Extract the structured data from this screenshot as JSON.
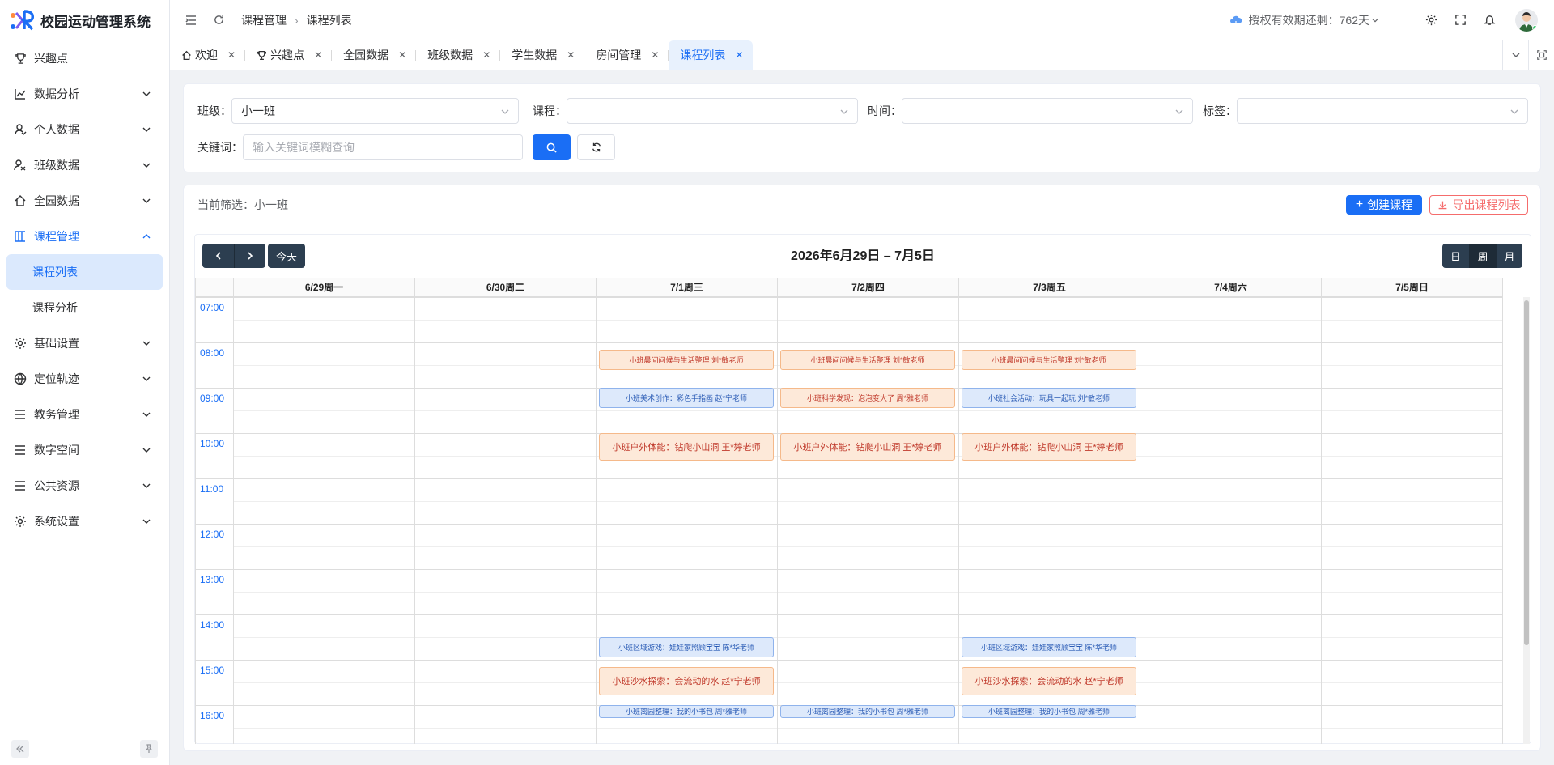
{
  "app": {
    "title": "校园运动管理系统"
  },
  "sidebar": {
    "items": [
      {
        "label": "兴趣点",
        "icon": "trophy-icon"
      },
      {
        "label": "数据分析",
        "icon": "chart-line-icon"
      },
      {
        "label": "个人数据",
        "icon": "user-icon"
      },
      {
        "label": "班级数据",
        "icon": "users-icon"
      },
      {
        "label": "全园数据",
        "icon": "home-icon"
      },
      {
        "label": "课程管理",
        "icon": "grid-icon"
      },
      {
        "label": "基础设置",
        "icon": "gear-icon"
      },
      {
        "label": "定位轨迹",
        "icon": "globe-icon"
      },
      {
        "label": "教务管理",
        "icon": "list-icon"
      },
      {
        "label": "数字空间",
        "icon": "list-icon"
      },
      {
        "label": "公共资源",
        "icon": "list-icon"
      },
      {
        "label": "系统设置",
        "icon": "gear-icon"
      }
    ],
    "sub_items": [
      {
        "label": "课程列表",
        "active": true
      },
      {
        "label": "课程分析",
        "active": false
      }
    ]
  },
  "header": {
    "breadcrumb": [
      "课程管理",
      "课程列表"
    ],
    "license": "授权有效期还剩：762天"
  },
  "tabs": [
    {
      "label": "欢迎",
      "icon": "home-icon",
      "active": false
    },
    {
      "label": "兴趣点",
      "icon": "trophy-icon",
      "active": false
    },
    {
      "label": "全园数据",
      "active": false
    },
    {
      "label": "班级数据",
      "active": false
    },
    {
      "label": "学生数据",
      "active": false
    },
    {
      "label": "房间管理",
      "active": false
    },
    {
      "label": "课程列表",
      "active": true
    }
  ],
  "filter": {
    "class_label": "班级：",
    "class_value": "小一班",
    "course_label": "课程：",
    "course_value": "",
    "time_label": "时间：",
    "time_value": "",
    "tag_label": "标签：",
    "tag_value": "",
    "keyword_label": "关键词：",
    "keyword_placeholder": "输入关键词模糊查询"
  },
  "main": {
    "current_filter": "当前筛选：小一班",
    "create_label": "创建课程",
    "export_label": "导出课程列表"
  },
  "calendar": {
    "title": "2026年6月29日 – 7月5日",
    "today_label": "今天",
    "views": [
      "日",
      "周",
      "月"
    ],
    "active_view": "周",
    "days": [
      "6/29周一",
      "6/30周二",
      "7/1周三",
      "7/2周四",
      "7/3周五",
      "7/4周六",
      "7/5周日"
    ],
    "times": [
      "07:00",
      "08:00",
      "09:00",
      "10:00",
      "11:00",
      "12:00",
      "13:00",
      "14:00",
      "15:00",
      "16:00"
    ],
    "events": [
      {
        "day": 2,
        "start": "08:10",
        "end": "08:40",
        "title": "小班晨间问候与生活整理 刘*敏老师",
        "color": "orange"
      },
      {
        "day": 3,
        "start": "08:10",
        "end": "08:40",
        "title": "小班晨间问候与生活整理 刘*敏老师",
        "color": "orange"
      },
      {
        "day": 4,
        "start": "08:10",
        "end": "08:40",
        "title": "小班晨间问候与生活整理 刘*敏老师",
        "color": "orange"
      },
      {
        "day": 2,
        "start": "09:00",
        "end": "09:30",
        "title": "小班美术创作：彩色手指画 赵*宁老师",
        "color": "blue"
      },
      {
        "day": 3,
        "start": "09:00",
        "end": "09:30",
        "title": "小班科学发现：泡泡变大了 周*雅老师",
        "color": "orange"
      },
      {
        "day": 4,
        "start": "09:00",
        "end": "09:30",
        "title": "小班社会活动：玩具一起玩 刘*敏老师",
        "color": "blue"
      },
      {
        "day": 2,
        "start": "10:00",
        "end": "10:40",
        "title": "小班户外体能：钻爬小山洞 王*婷老师",
        "color": "orange"
      },
      {
        "day": 3,
        "start": "10:00",
        "end": "10:40",
        "title": "小班户外体能：钻爬小山洞 王*婷老师",
        "color": "orange"
      },
      {
        "day": 4,
        "start": "10:00",
        "end": "10:40",
        "title": "小班户外体能：钻爬小山洞 王*婷老师",
        "color": "orange"
      },
      {
        "day": 2,
        "start": "14:30",
        "end": "15:00",
        "title": "小班区域游戏：娃娃家照顾宝宝 陈*华老师",
        "color": "blue"
      },
      {
        "day": 4,
        "start": "14:30",
        "end": "15:00",
        "title": "小班区域游戏：娃娃家照顾宝宝 陈*华老师",
        "color": "blue"
      },
      {
        "day": 2,
        "start": "15:10",
        "end": "15:50",
        "title": "小班沙水探索：会流动的水 赵*宁老师",
        "color": "orange"
      },
      {
        "day": 4,
        "start": "15:10",
        "end": "15:50",
        "title": "小班沙水探索：会流动的水 赵*宁老师",
        "color": "orange"
      },
      {
        "day": 2,
        "start": "16:00",
        "end": "16:20",
        "title": "小班离园整理：我的小书包 周*雅老师",
        "color": "blue"
      },
      {
        "day": 3,
        "start": "16:00",
        "end": "16:20",
        "title": "小班离园整理：我的小书包 周*雅老师",
        "color": "blue"
      },
      {
        "day": 4,
        "start": "16:00",
        "end": "16:20",
        "title": "小班离园整理：我的小书包 周*雅老师",
        "color": "blue"
      }
    ]
  },
  "colors": {
    "accent": "#1a6ef5",
    "danger": "#f56c6c",
    "calendar_button": "#2c3e50"
  }
}
